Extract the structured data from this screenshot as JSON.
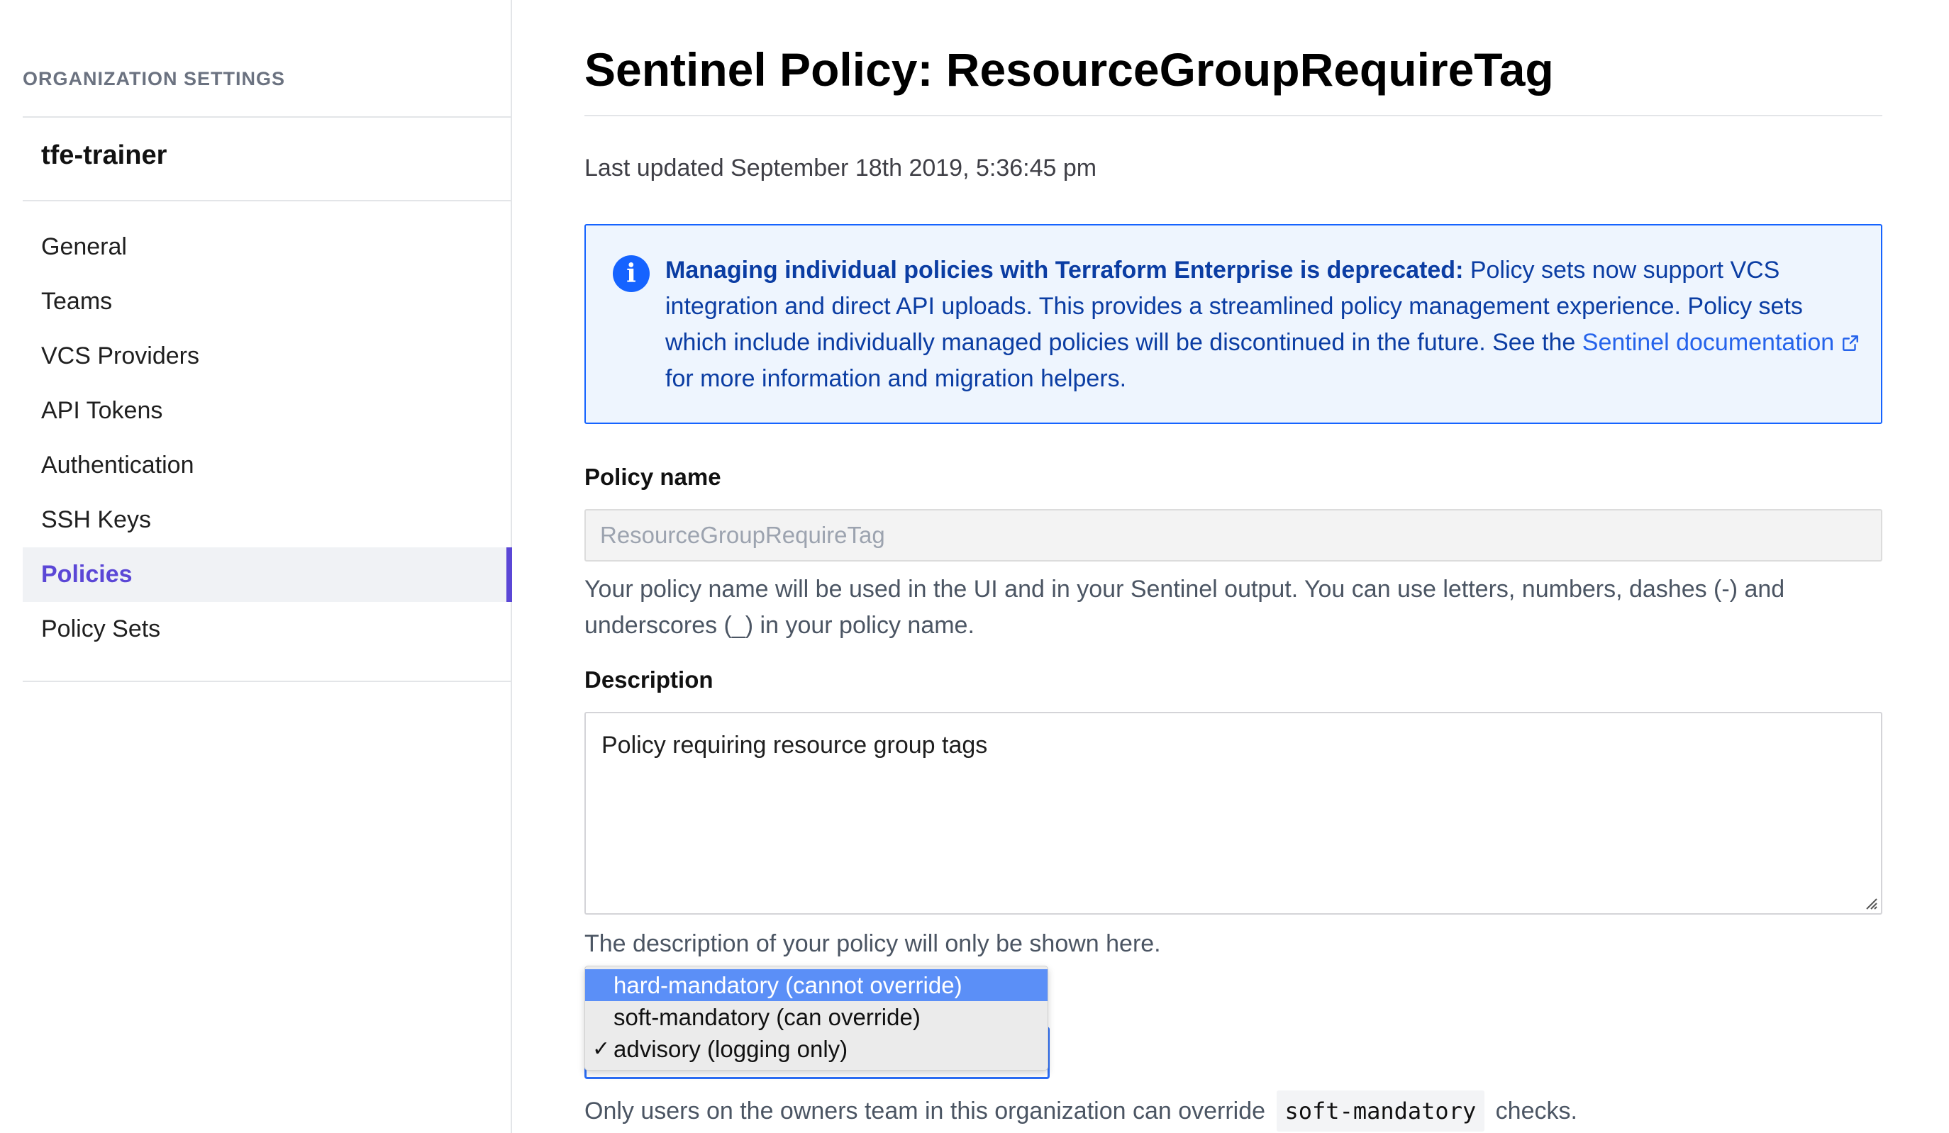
{
  "sidebar": {
    "heading": "ORGANIZATION SETTINGS",
    "org_name": "tfe-trainer",
    "items": [
      {
        "label": "General",
        "active": false
      },
      {
        "label": "Teams",
        "active": false
      },
      {
        "label": "VCS Providers",
        "active": false
      },
      {
        "label": "API Tokens",
        "active": false
      },
      {
        "label": "Authentication",
        "active": false
      },
      {
        "label": "SSH Keys",
        "active": false
      },
      {
        "label": "Policies",
        "active": true
      },
      {
        "label": "Policy Sets",
        "active": false
      }
    ],
    "accent_color": "#5b47d6"
  },
  "main": {
    "title": "Sentinel Policy: ResourceGroupRequireTag",
    "last_updated": "Last updated September 18th 2019, 5:36:45 pm",
    "notice": {
      "icon": "info-icon",
      "bold": "Managing individual policies with Terraform Enterprise is deprecated:",
      "text_before_link": " Policy sets now support VCS integration and direct API uploads. This provides a streamlined policy management experience. Policy sets which include individually managed policies will be discontinued in the future. See the ",
      "link_text": "Sentinel documentation",
      "link_icon": "external-link-icon",
      "text_after_link": " for more information and migration helpers.",
      "border_color": "#1563ff"
    },
    "policy_name": {
      "label": "Policy name",
      "value": "ResourceGroupRequireTag",
      "help": "Your policy name will be used in the UI and in your Sentinel output. You can use letters, numbers, dashes (-) and underscores (_) in your policy name."
    },
    "description": {
      "label": "Description",
      "value": "Policy requiring resource group tags",
      "help": "The description of your policy will only be shown here."
    },
    "enforcement": {
      "options": [
        {
          "label": "hard-mandatory (cannot override)",
          "highlighted": true,
          "checked": false
        },
        {
          "label": "soft-mandatory (can override)",
          "highlighted": false,
          "checked": false
        },
        {
          "label": "advisory (logging only)",
          "highlighted": false,
          "checked": true
        }
      ],
      "check_glyph": "✓",
      "note_before": "Only users on the owners team in this organization can override ",
      "note_code": "soft-mandatory",
      "note_after": " checks."
    }
  }
}
